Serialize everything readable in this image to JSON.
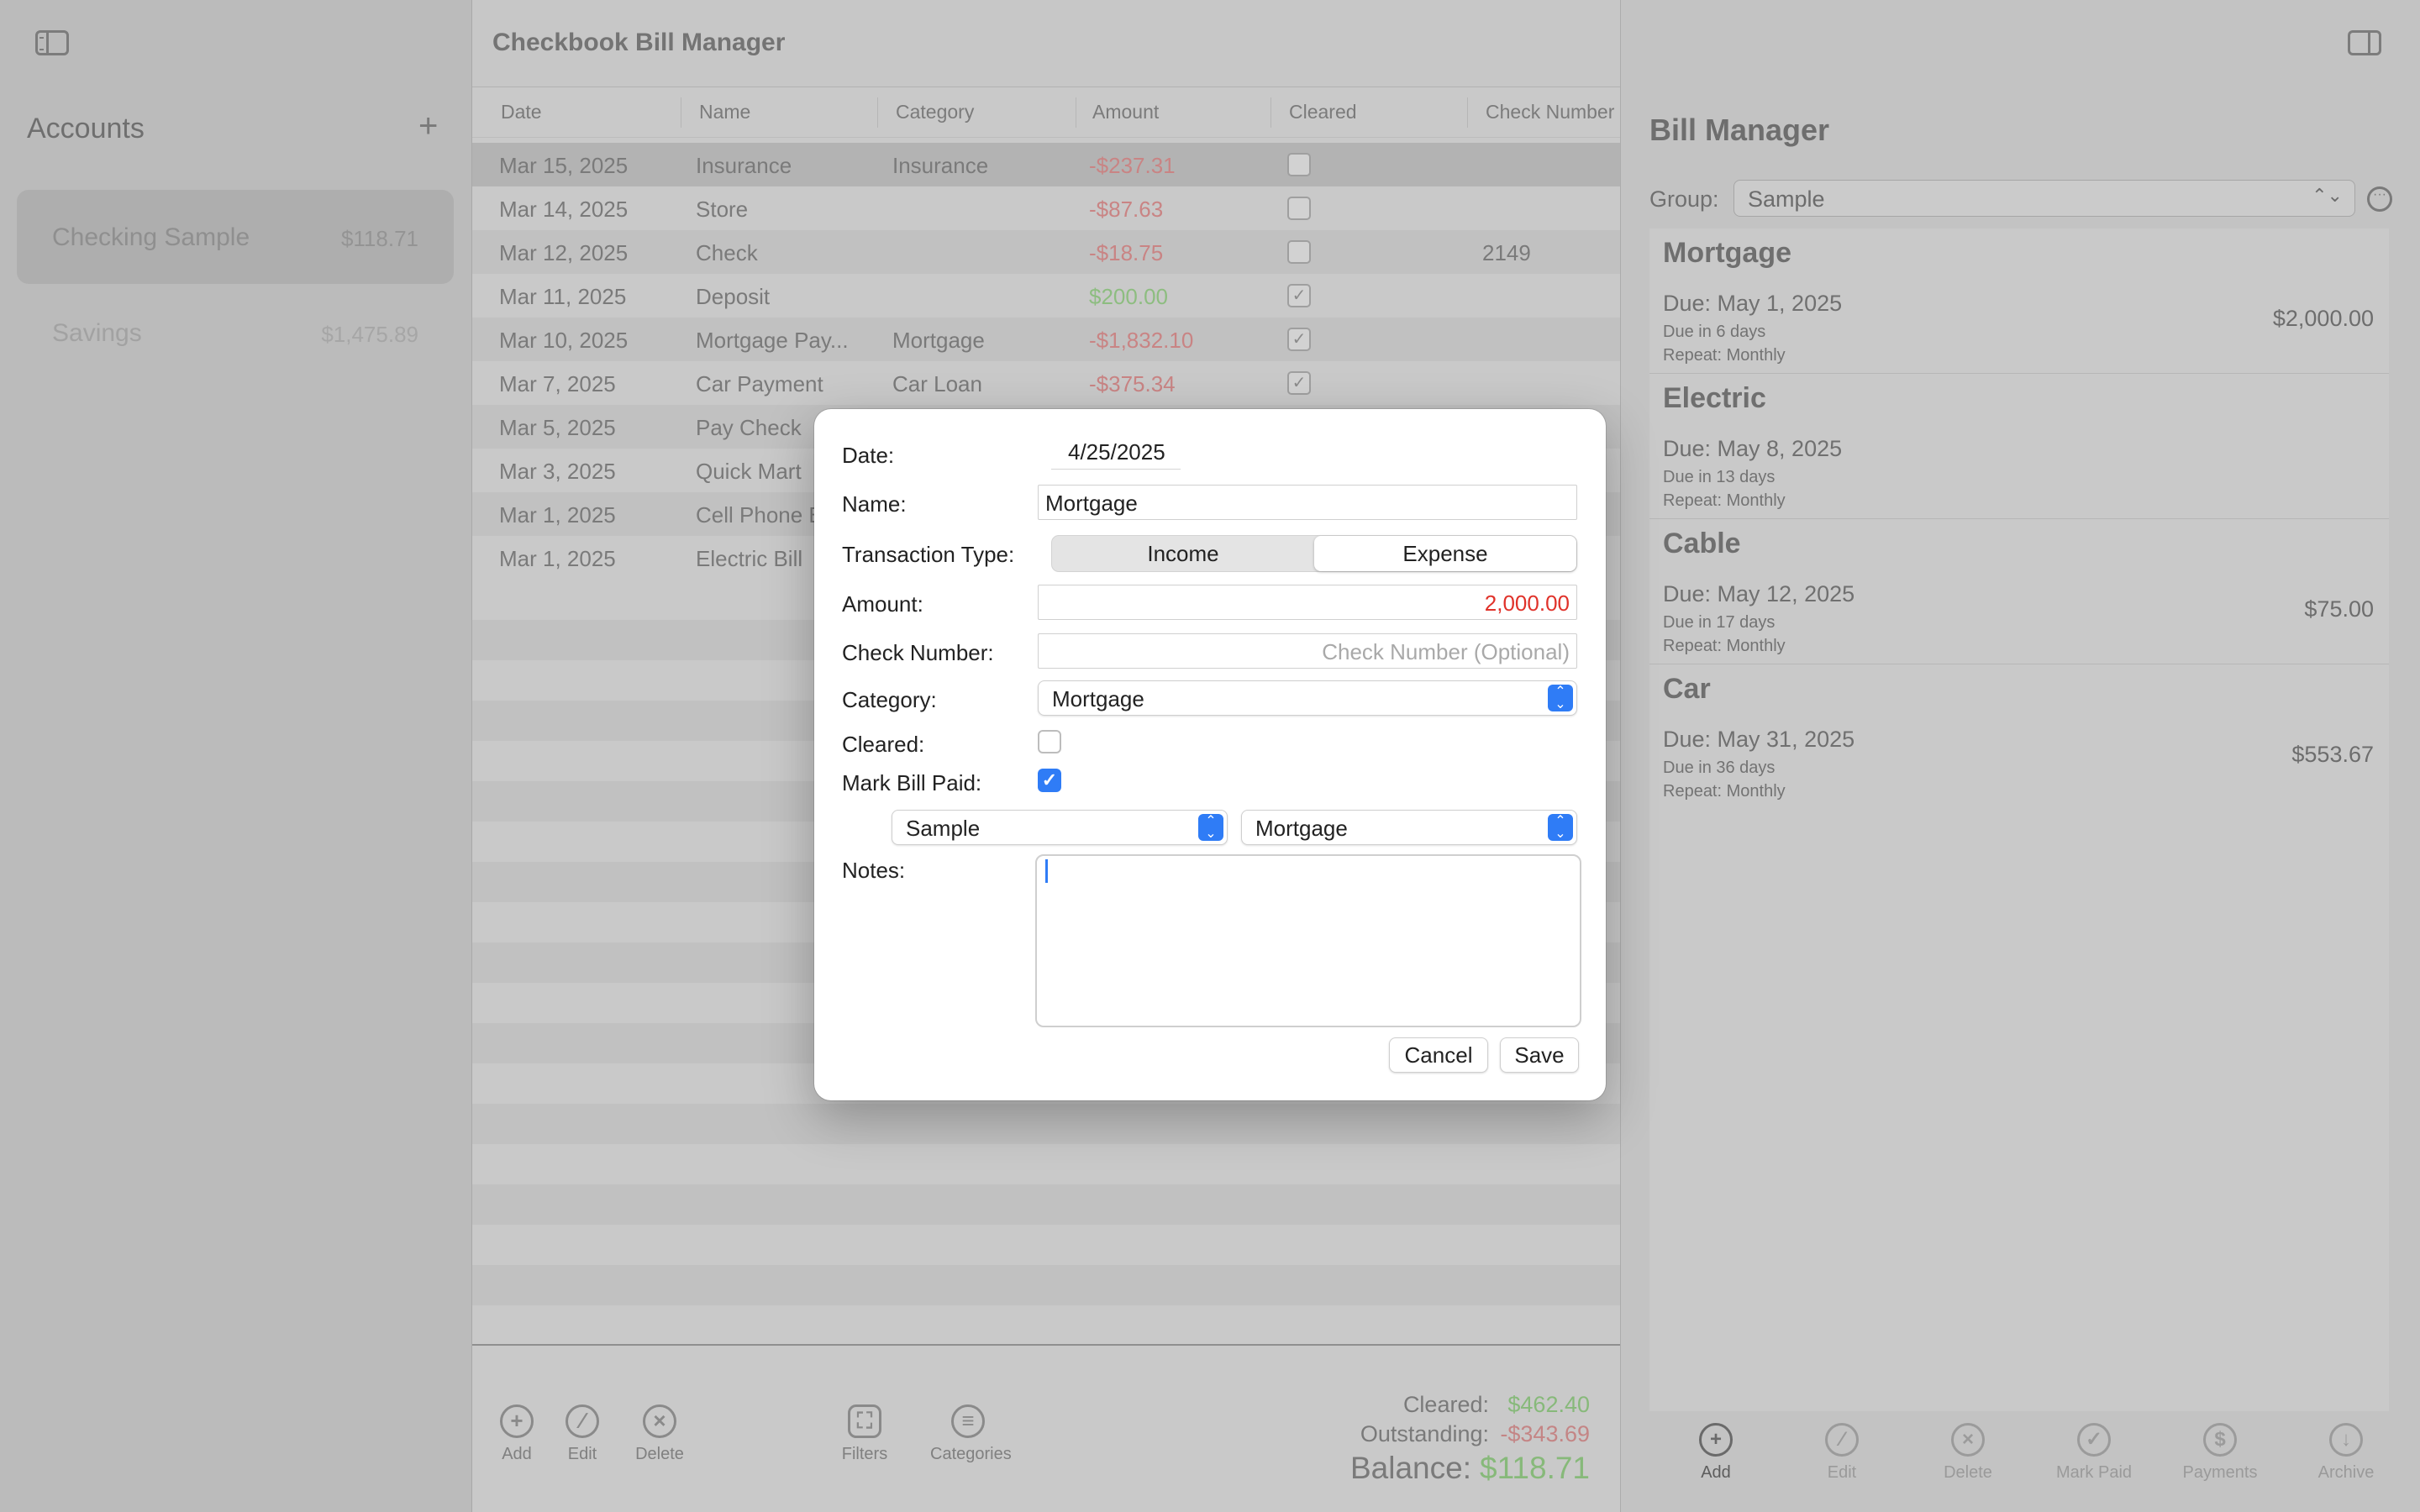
{
  "window": {
    "title": "Checkbook Bill Manager"
  },
  "sidebar": {
    "title": "Accounts",
    "add_label": "+",
    "accounts": [
      {
        "name": "Checking Sample",
        "balance": "$118.71",
        "selected": true
      },
      {
        "name": "Savings",
        "balance": "$1,475.89",
        "selected": false
      }
    ]
  },
  "table": {
    "columns": [
      "Date",
      "Name",
      "Category",
      "Amount",
      "Cleared",
      "Check Number"
    ],
    "rows": [
      {
        "date": "Mar 15, 2025",
        "name": "Insurance",
        "category": "Insurance",
        "amount": "-$237.31",
        "cleared": false,
        "check": ""
      },
      {
        "date": "Mar 14, 2025",
        "name": "Store",
        "category": "",
        "amount": "-$87.63",
        "cleared": false,
        "check": ""
      },
      {
        "date": "Mar 12, 2025",
        "name": "Check",
        "category": "",
        "amount": "-$18.75",
        "cleared": false,
        "check": "2149"
      },
      {
        "date": "Mar 11, 2025",
        "name": "Deposit",
        "category": "",
        "amount": "$200.00",
        "cleared": true,
        "check": ""
      },
      {
        "date": "Mar 10, 2025",
        "name": "Mortgage Pay...",
        "category": "Mortgage",
        "amount": "-$1,832.10",
        "cleared": true,
        "check": ""
      },
      {
        "date": "Mar 7, 2025",
        "name": "Car Payment",
        "category": "Car Loan",
        "amount": "-$375.34",
        "cleared": true,
        "check": ""
      },
      {
        "date": "Mar 5, 2025",
        "name": "Pay Check",
        "category": "",
        "amount": "",
        "cleared": null,
        "check": ""
      },
      {
        "date": "Mar 3, 2025",
        "name": "Quick Mart",
        "category": "",
        "amount": "",
        "cleared": null,
        "check": ""
      },
      {
        "date": "Mar 1, 2025",
        "name": "Cell Phone B",
        "category": "",
        "amount": "",
        "cleared": null,
        "check": ""
      },
      {
        "date": "Mar 1, 2025",
        "name": "Electric Bill",
        "category": "",
        "amount": "",
        "cleared": null,
        "check": ""
      }
    ]
  },
  "toolbar": {
    "add": "Add",
    "edit": "Edit",
    "delete": "Delete",
    "filters": "Filters",
    "categories": "Categories"
  },
  "totals": {
    "cleared_label": "Cleared:",
    "cleared_value": "$462.40",
    "outstanding_label": "Outstanding:",
    "outstanding_value": "-$343.69",
    "balance_label": "Balance:",
    "balance_value": "$118.71"
  },
  "bill_manager": {
    "title": "Bill Manager",
    "group_label": "Group:",
    "group_value": "Sample",
    "bills": [
      {
        "name": "Mortgage",
        "due": "Due: May 1, 2025",
        "due_in": "Due in 6 days",
        "repeat": "Repeat: Monthly",
        "amount": "$2,000.00"
      },
      {
        "name": "Electric",
        "due": "Due: May 8, 2025",
        "due_in": "Due in 13 days",
        "repeat": "Repeat: Monthly",
        "amount": ""
      },
      {
        "name": "Cable",
        "due": "Due: May 12, 2025",
        "due_in": "Due in 17 days",
        "repeat": "Repeat: Monthly",
        "amount": "$75.00"
      },
      {
        "name": "Car",
        "due": "Due: May 31, 2025",
        "due_in": "Due in 36 days",
        "repeat": "Repeat: Monthly",
        "amount": "$553.67"
      }
    ],
    "toolbar": {
      "add": "Add",
      "edit": "Edit",
      "delete": "Delete",
      "mark_paid": "Mark Paid",
      "payments": "Payments",
      "archive": "Archive"
    }
  },
  "dialog": {
    "date_label": "Date:",
    "date_value": "4/25/2025",
    "name_label": "Name:",
    "name_value": "Mortgage",
    "type_label": "Transaction Type:",
    "type_income": "Income",
    "type_expense": "Expense",
    "type_selected": "Expense",
    "amount_label": "Amount:",
    "amount_value": "2,000.00",
    "check_label": "Check Number:",
    "check_placeholder": "Check Number (Optional)",
    "category_label": "Category:",
    "category_value": "Mortgage",
    "cleared_label": "Cleared:",
    "cleared_checked": false,
    "paid_label": "Mark Bill Paid:",
    "paid_checked": true,
    "bill_group_value": "Sample",
    "bill_value": "Mortgage",
    "notes_label": "Notes:",
    "notes_value": "",
    "cancel": "Cancel",
    "save": "Save"
  },
  "colors": {
    "accent": "#2f7cf6",
    "negative": "#e0322a",
    "positive_dim": "#8dbd80",
    "negative_dim": "#c98484"
  }
}
